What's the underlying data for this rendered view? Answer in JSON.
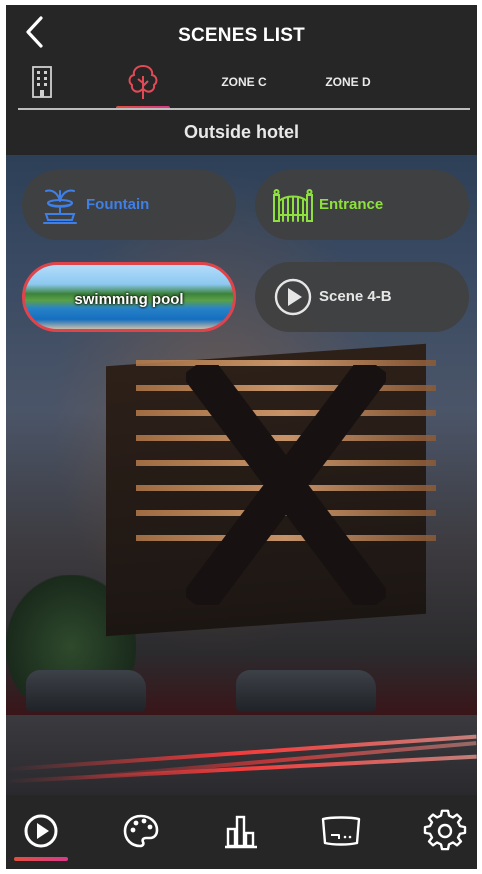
{
  "header": {
    "title": "SCENES LIST",
    "subtitle": "Outside hotel",
    "tabs": [
      {
        "label": "",
        "icon": "building-icon"
      },
      {
        "label": "",
        "icon": "tree-icon",
        "selected": true
      },
      {
        "label": "ZONE C"
      },
      {
        "label": "ZONE D"
      }
    ]
  },
  "scenes": [
    {
      "label": "Fountain",
      "icon": "fountain-icon",
      "color": "#3f7fe8"
    },
    {
      "label": "Entrance",
      "icon": "gate-icon",
      "color": "#8ee03c"
    },
    {
      "label": "swimming pool",
      "selected": true
    },
    {
      "label": "Scene 4-B",
      "icon": "play-circle-icon",
      "color": "#e6e6e6"
    }
  ],
  "bottom_nav": [
    {
      "icon": "play-circle-icon",
      "selected": true
    },
    {
      "icon": "palette-icon"
    },
    {
      "icon": "bar-chart-icon"
    },
    {
      "icon": "screen-icon"
    },
    {
      "icon": "gear-icon"
    }
  ],
  "colors": {
    "background": "#262626",
    "accent": "#e34f3d",
    "accent2": "#d93a8b"
  }
}
